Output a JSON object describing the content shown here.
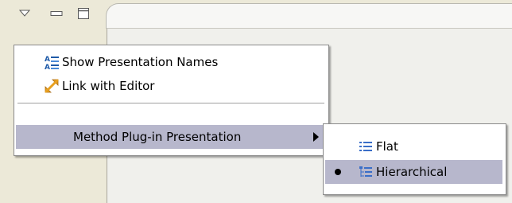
{
  "view_toolbar": {
    "icons": [
      "view-menu-icon",
      "minimize-icon",
      "maximize-icon"
    ]
  },
  "main_menu": {
    "items": [
      {
        "label": "Show Presentation Names",
        "icon": "presentation-names-icon"
      },
      {
        "label": "Link with Editor",
        "icon": "link-arrows-icon"
      },
      {
        "label": "Method Plug-in Presentation",
        "submenu": true,
        "selected": true
      }
    ]
  },
  "submenu": {
    "items": [
      {
        "label": "Flat",
        "icon": "flat-list-icon",
        "checked": false
      },
      {
        "label": "Hierarchical",
        "icon": "hierarchical-tree-icon",
        "checked": true,
        "selected": true
      }
    ]
  },
  "colors": {
    "menu_highlight": "#b7b7cc",
    "chrome_background": "#ece9d8",
    "menu_border": "#8a8a8a"
  }
}
